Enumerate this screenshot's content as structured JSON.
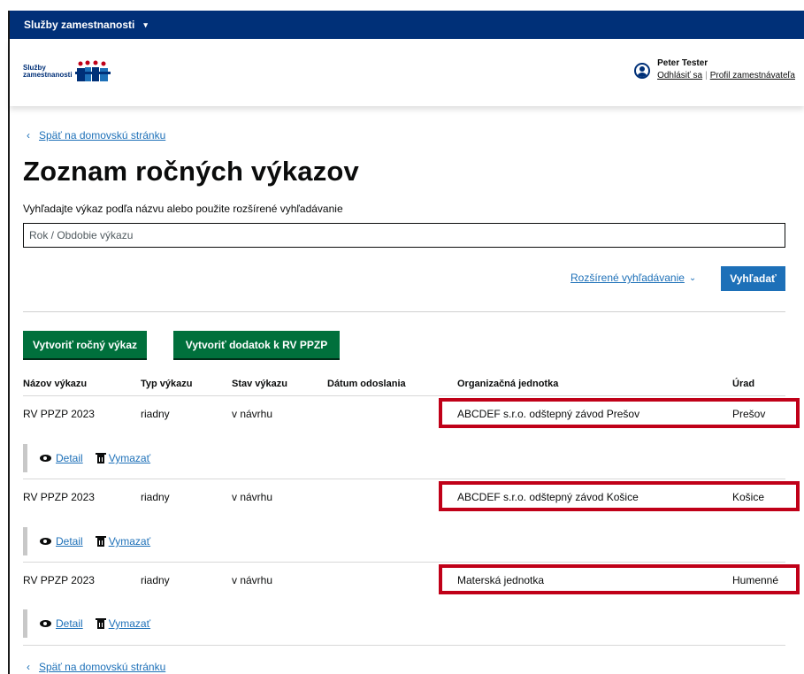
{
  "topbar": {
    "title": "Služby zamestnanosti",
    "caret": "▾"
  },
  "header": {
    "logo_text_line1": "Služby",
    "logo_text_line2": "zamestnanosti",
    "user_name": "Peter Tester",
    "logout": "Odhlásiť sa",
    "separator": "|",
    "profile": "Profil zamestnávateľa"
  },
  "nav": {
    "back_chevron": "‹",
    "back_top": "Späť na domovskú stránku",
    "back_bottom": "Späť na domovskú stránku"
  },
  "page": {
    "title": "Zoznam ročných výkazov",
    "hint": "Vyhľadajte výkaz podľa názvu alebo použite rozšírené vyhľadávanie",
    "search_placeholder": "Rok / Obdobie výkazu",
    "advanced_search": "Rozšírené vyhľadávanie",
    "advanced_chevron": "⌄",
    "search_button": "Vyhľadať",
    "create_report": "Vytvoriť ročný výkaz",
    "create_supplement": "Vytvoriť dodatok k RV PPZP"
  },
  "table": {
    "headers": [
      "Názov výkazu",
      "Typ výkazu",
      "Stav výkazu",
      "Dátum odoslania",
      "Organizačná jednotka",
      "Úrad"
    ],
    "rows": [
      {
        "name": "RV PPZP 2023",
        "type": "riadny",
        "status": "v návrhu",
        "date": "",
        "unit": "ABCDEF s.r.o. odštepný závod Prešov",
        "office": "Prešov"
      },
      {
        "name": "RV PPZP 2023",
        "type": "riadny",
        "status": "v návrhu",
        "date": "",
        "unit": "ABCDEF s.r.o. odštepný závod Košice",
        "office": "Košice"
      },
      {
        "name": "RV PPZP 2023",
        "type": "riadny",
        "status": "v návrhu",
        "date": "",
        "unit": "Materská jednotka",
        "office": "Humenné"
      }
    ],
    "actions": {
      "detail": "Detail",
      "delete": "Vymazať"
    }
  },
  "colors": {
    "topbar": "#003078",
    "link": "#1d70b8",
    "green_button": "#00703c",
    "highlight": "#c00018"
  }
}
